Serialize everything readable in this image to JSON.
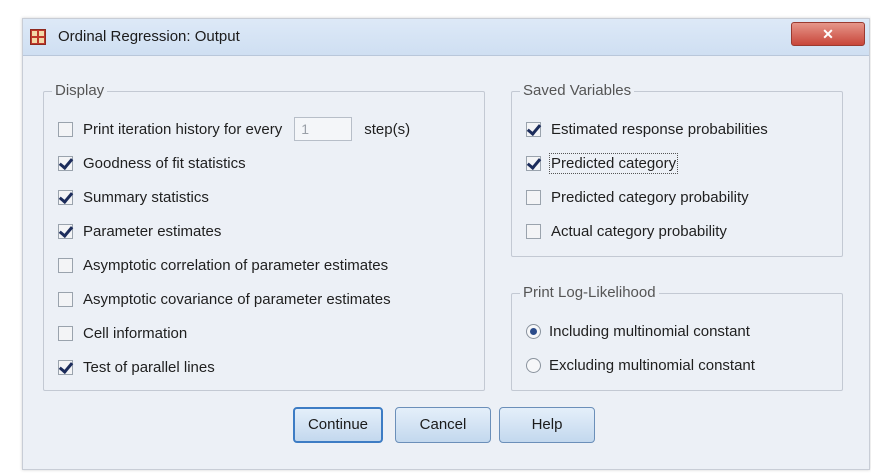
{
  "window": {
    "title": "Ordinal Regression: Output",
    "close_symbol": "✕"
  },
  "display": {
    "legend": "Display",
    "iteration": {
      "label": "Print iteration history for every",
      "value": "1",
      "suffix": "step(s)",
      "checked": false
    },
    "items": [
      {
        "label": "Goodness of fit statistics",
        "checked": true
      },
      {
        "label": "Summary statistics",
        "checked": true
      },
      {
        "label": "Parameter estimates",
        "checked": true
      },
      {
        "label": "Asymptotic correlation of parameter estimates",
        "checked": false
      },
      {
        "label": "Asymptotic covariance of parameter estimates",
        "checked": false
      },
      {
        "label": "Cell information",
        "checked": false
      },
      {
        "label": "Test of parallel lines",
        "checked": true
      }
    ]
  },
  "saved_variables": {
    "legend": "Saved Variables",
    "items": [
      {
        "label": "Estimated response probabilities",
        "checked": true
      },
      {
        "label": "Predicted category",
        "checked": true
      },
      {
        "label": "Predicted category probability",
        "checked": false
      },
      {
        "label": "Actual category probability",
        "checked": false
      }
    ]
  },
  "log_likelihood": {
    "legend": "Print Log-Likelihood",
    "options": [
      {
        "label": "Including multinomial constant",
        "selected": true
      },
      {
        "label": "Excluding multinomial constant",
        "selected": false
      }
    ]
  },
  "buttons": {
    "continue": "Continue",
    "cancel": "Cancel",
    "help": "Help"
  }
}
